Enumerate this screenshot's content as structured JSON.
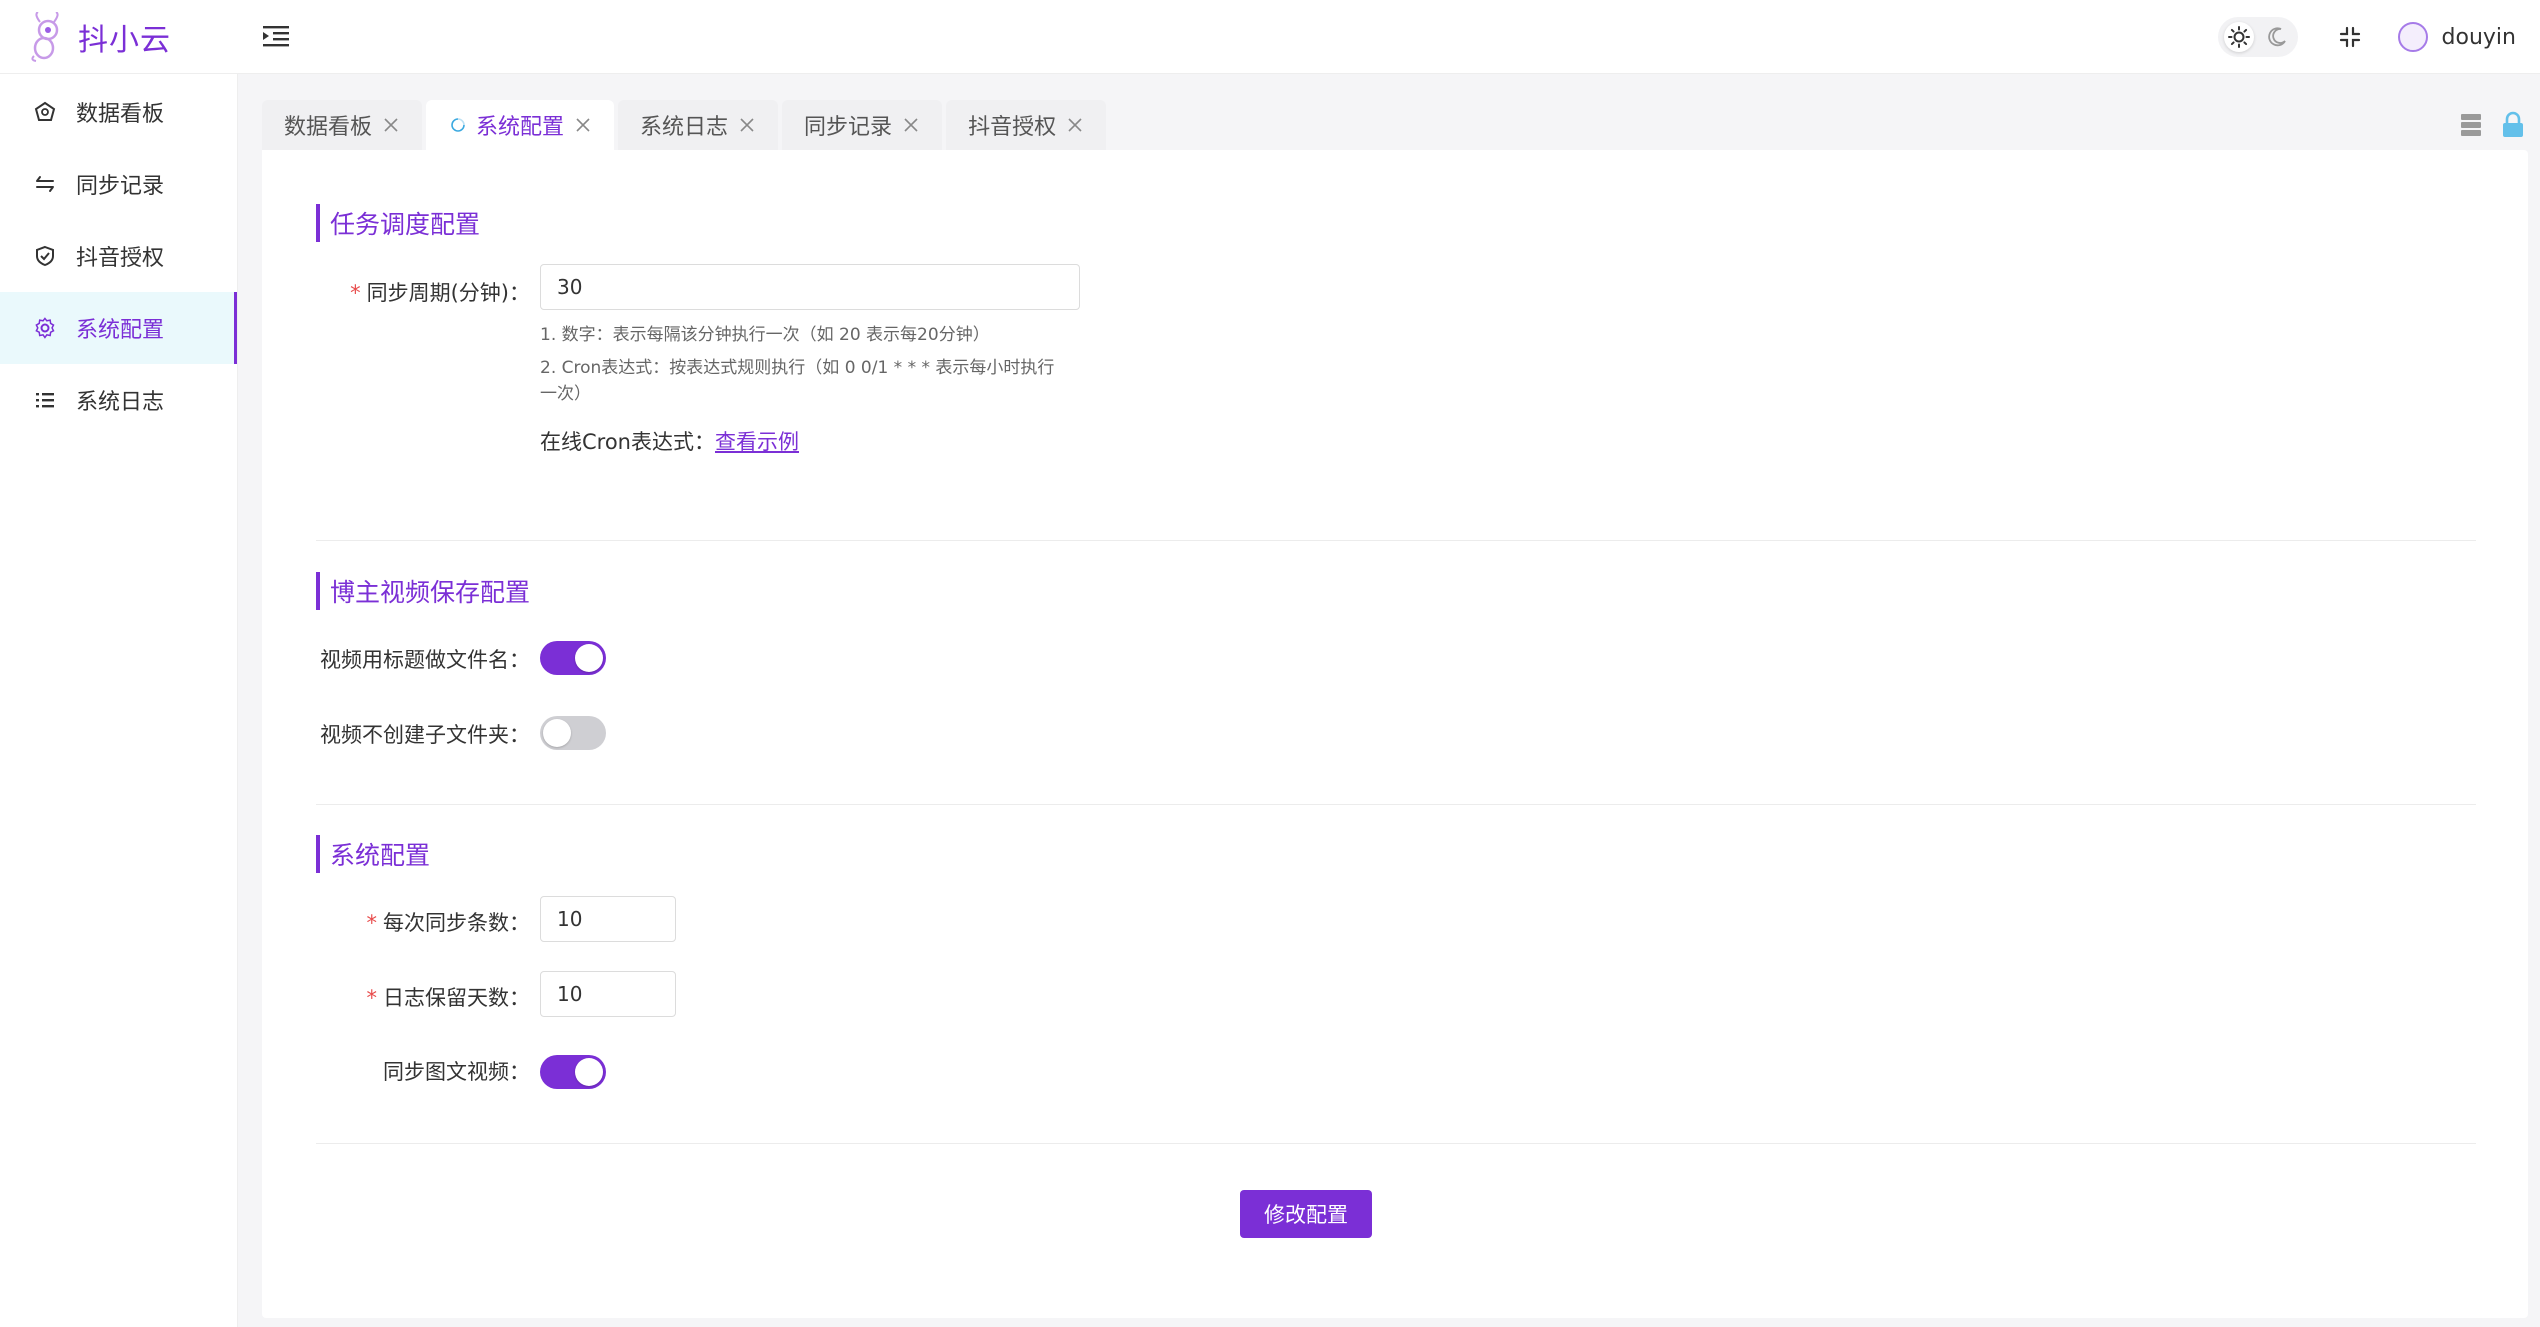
{
  "app": {
    "name": "抖小云"
  },
  "header": {
    "username": "douyin"
  },
  "sidebar": {
    "items": [
      {
        "label": "数据看板",
        "icon": "dashboard-icon"
      },
      {
        "label": "同步记录",
        "icon": "sync-icon"
      },
      {
        "label": "抖音授权",
        "icon": "shield-icon"
      },
      {
        "label": "系统配置",
        "icon": "gear-icon",
        "active": true
      },
      {
        "label": "系统日志",
        "icon": "list-icon"
      }
    ]
  },
  "tabs": [
    {
      "label": "数据看板"
    },
    {
      "label": "系统配置",
      "active": true
    },
    {
      "label": "系统日志"
    },
    {
      "label": "同步记录"
    },
    {
      "label": "抖音授权"
    }
  ],
  "sections": {
    "schedule": {
      "title": "任务调度配置",
      "period_label": "同步周期(分钟)：",
      "period_value": "30",
      "hint_1": "1. 数字：表示每隔该分钟执行一次（如 20 表示每20分钟）",
      "hint_2": "2. Cron表达式：按表达式规则执行（如 0 0/1 * * * 表示每小时执行一次）",
      "online_label": "在线Cron表达式：",
      "online_link": "查看示例"
    },
    "video": {
      "title": "博主视频保存配置",
      "title_as_name_label": "视频用标题做文件名：",
      "title_as_name_on": true,
      "no_subfolder_label": "视频不创建子文件夹：",
      "no_subfolder_on": false
    },
    "system": {
      "title": "系统配置",
      "per_sync_label": "每次同步条数：",
      "per_sync_value": "10",
      "log_days_label": "日志保留天数：",
      "log_days_value": "10",
      "sync_image_video_label": "同步图文视频：",
      "sync_image_video_on": true
    }
  },
  "actions": {
    "submit_label": "修改配置"
  },
  "colors": {
    "accent": "#7b2fd6",
    "active_bg": "#eaf9fc",
    "required": "#e84c4c"
  }
}
